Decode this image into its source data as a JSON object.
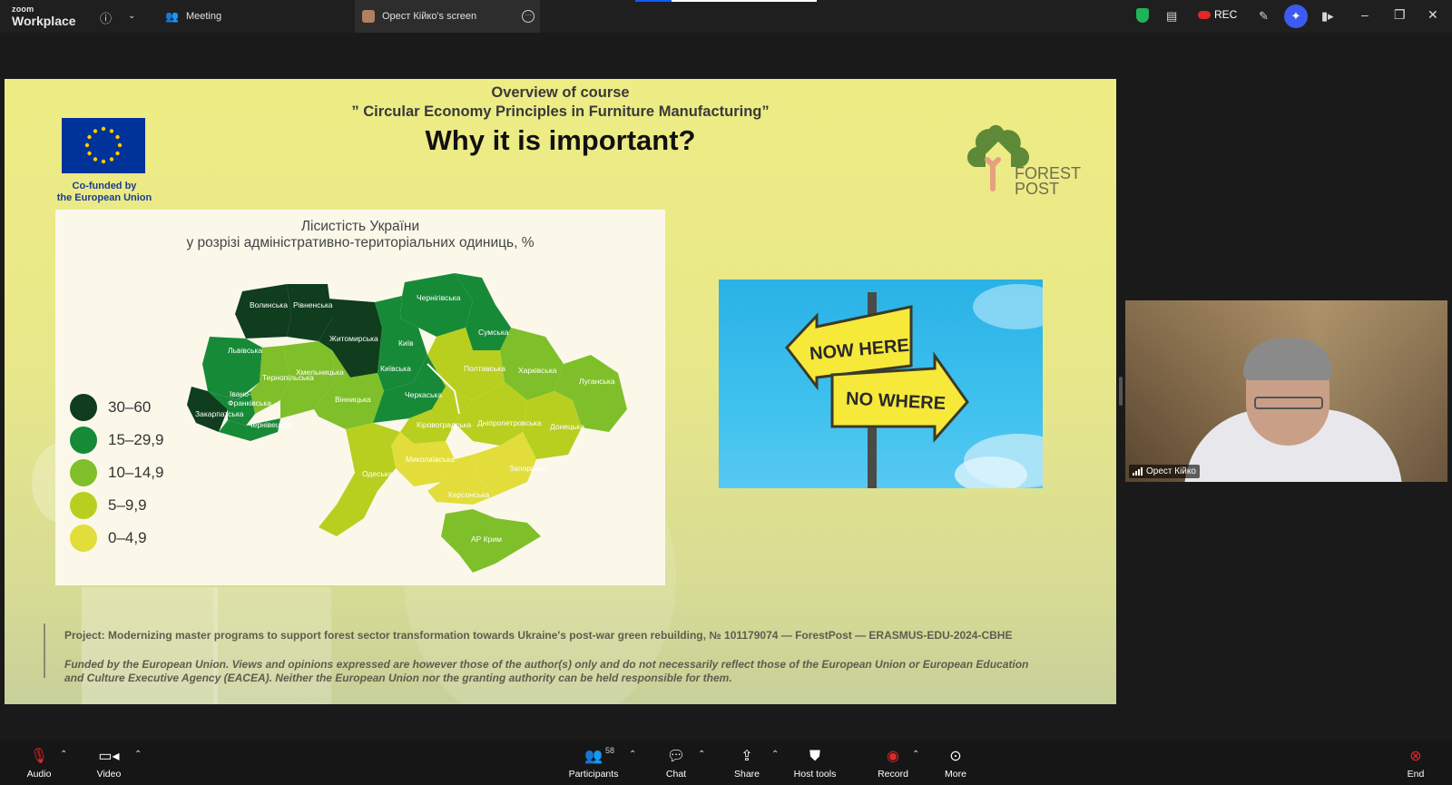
{
  "app": {
    "brand_small": "zoom",
    "brand": "Workplace"
  },
  "tabs": {
    "meeting": "Meeting",
    "screen": "Орест Кійко's screen"
  },
  "topbar": {
    "rec_label": "REC"
  },
  "slide": {
    "title_line1": "Overview of course",
    "title_line2": "” Circular Economy Principles in Furniture Manufacturing”",
    "heading": "Why it is important?",
    "eu_caption_line1": "Co-funded by",
    "eu_caption_line2": "the European Union",
    "logo_line1": "FOREST",
    "logo_line2": "POST",
    "map_title_line1": "Лісистість України",
    "map_title_line2": "у розрізі адміністративно-територіальних одиниць, %",
    "legend": [
      {
        "label": "30–60",
        "color": "#0f3d1e"
      },
      {
        "label": "15–29,9",
        "color": "#178a38"
      },
      {
        "label": "10–14,9",
        "color": "#7fbf2a"
      },
      {
        "label": "5–9,9",
        "color": "#b8cf1f"
      },
      {
        "label": "0–4,9",
        "color": "#e2dd3a"
      }
    ],
    "regions": {
      "volyn": "Волинська",
      "rivne": "Рівненська",
      "chernihiv": "Чернігівська",
      "sumy": "Сумська",
      "zhytomyr": "Житомирська",
      "lviv": "Львівська",
      "kyiv_city": "Київ",
      "kyiv": "Київська",
      "poltava": "Полтавська",
      "kharkiv": "Харківська",
      "luhansk": "Луганська",
      "ternopil": "Тернопільська",
      "khmelnytskyi": "Хмельницька",
      "vinnytsia": "Вінницька",
      "cherkasy": "Черкаська",
      "ivano_frankivsk_1": "Івано-",
      "ivano_frankivsk_2": "Франківська",
      "zakarpattia": "Закарпатська",
      "chernivtsi": "Чернівецька",
      "kirovohrad": "Кіровоградська",
      "dnipro": "Дніпропетровська",
      "donetsk": "Донецька",
      "mykolaiv": "Миколаївська",
      "zaporizhzhia": "Запорізька",
      "odesa": "Одеська",
      "kherson": "Херсонська",
      "crimea": "АР Крим"
    },
    "sign_upper": "NOW HERE",
    "sign_lower": "NO WHERE",
    "footer_project": "Project: Modernizing master programs to support forest sector transformation towards Ukraine's post-war green rebuilding, № 101179074 — ForestPost — ERASMUS-EDU-2024-CBHE",
    "footer_disclaimer": "Funded by the European Union. Views and opinions expressed are however those of the author(s) only and do not necessarily reflect those of the European Union or European Education and Culture Executive Agency (EACEA). Neither the European Union nor the granting authority can be held responsible for them."
  },
  "video": {
    "participant_name": "Орест Кійко"
  },
  "toolbar": {
    "audio": "Audio",
    "video": "Video",
    "participants": "Participants",
    "participants_count": "58",
    "chat": "Chat",
    "share": "Share",
    "host_tools": "Host tools",
    "record": "Record",
    "more": "More",
    "end": "End"
  },
  "colors": {
    "accent": "#0b5cff",
    "record": "#e02828",
    "end": "#e02828"
  }
}
